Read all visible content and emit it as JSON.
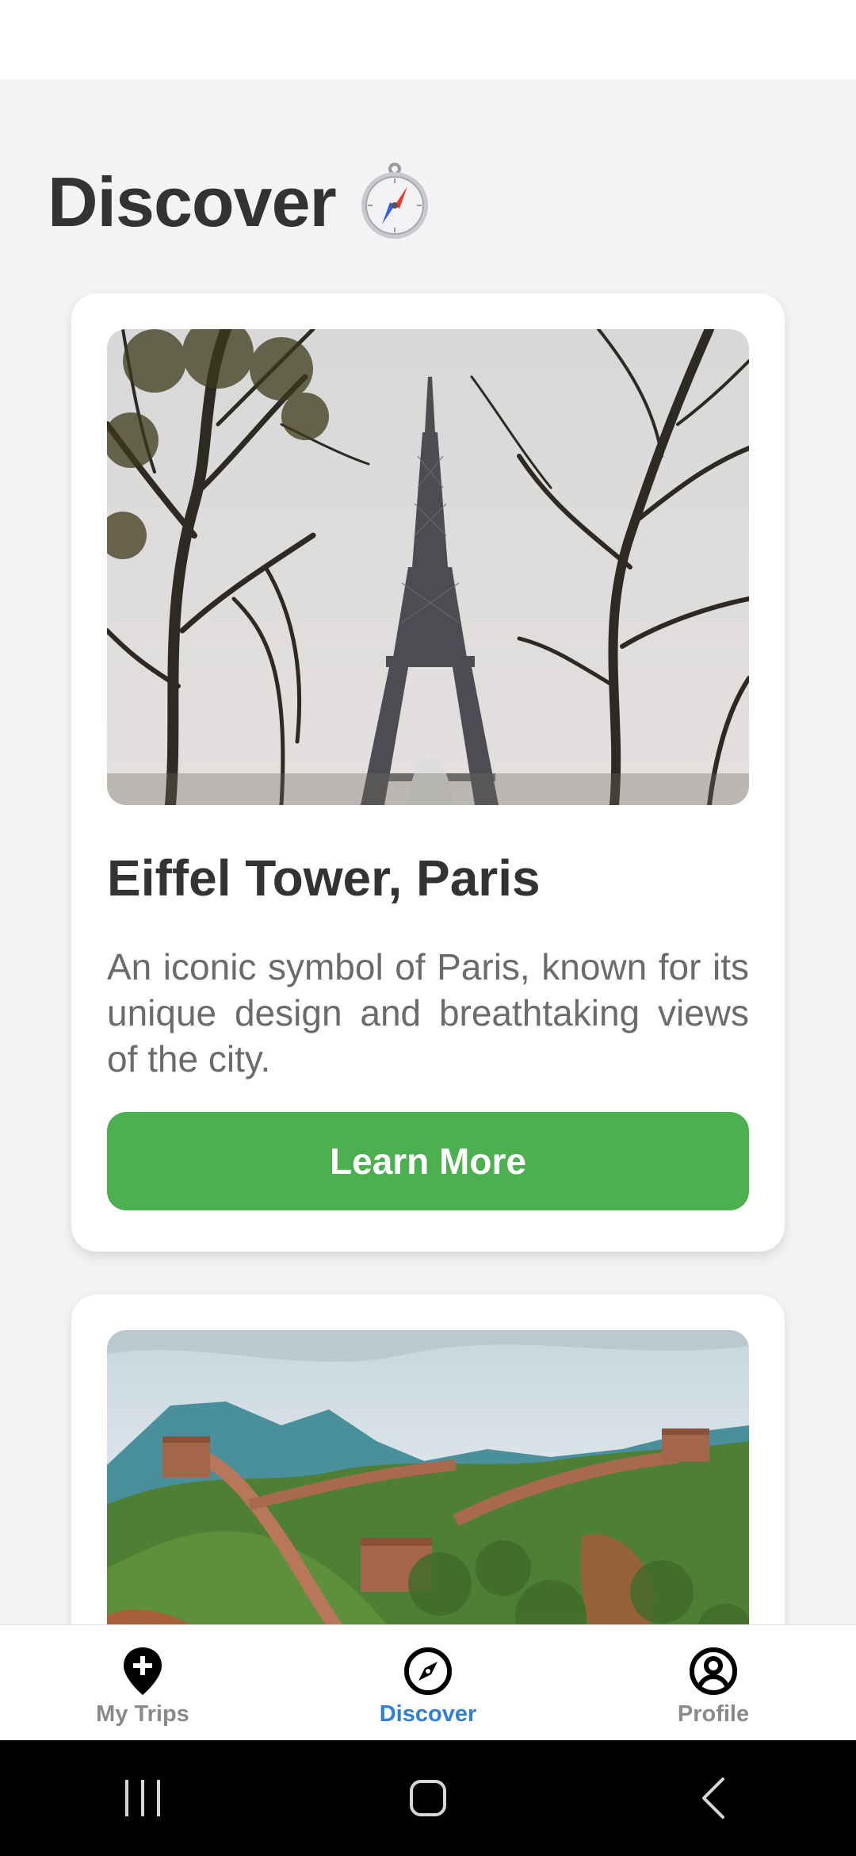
{
  "header": {
    "title": "Discover",
    "title_emoji": "compass-emoji"
  },
  "cards": [
    {
      "image": "eiffel-tower-photo",
      "title": "Eiffel Tower, Paris",
      "description": "An iconic symbol of Paris, known for its unique design and breathtaking views of the city.",
      "button_label": "Learn More"
    },
    {
      "image": "great-wall-photo"
    }
  ],
  "bottom_nav": {
    "items": [
      {
        "label": "My Trips",
        "icon": "map-pin-plus-icon",
        "active": false
      },
      {
        "label": "Discover",
        "icon": "compass-icon",
        "active": true
      },
      {
        "label": "Profile",
        "icon": "user-circle-icon",
        "active": false
      }
    ]
  },
  "system_nav": {
    "buttons": [
      "recent-apps-icon",
      "home-icon",
      "back-icon"
    ]
  },
  "colors": {
    "accent_green": "#4caf50",
    "active_blue": "#2f7fd6",
    "inactive_gray": "#8a8a8a",
    "background": "#f4f4f4",
    "card_background": "#ffffff"
  }
}
